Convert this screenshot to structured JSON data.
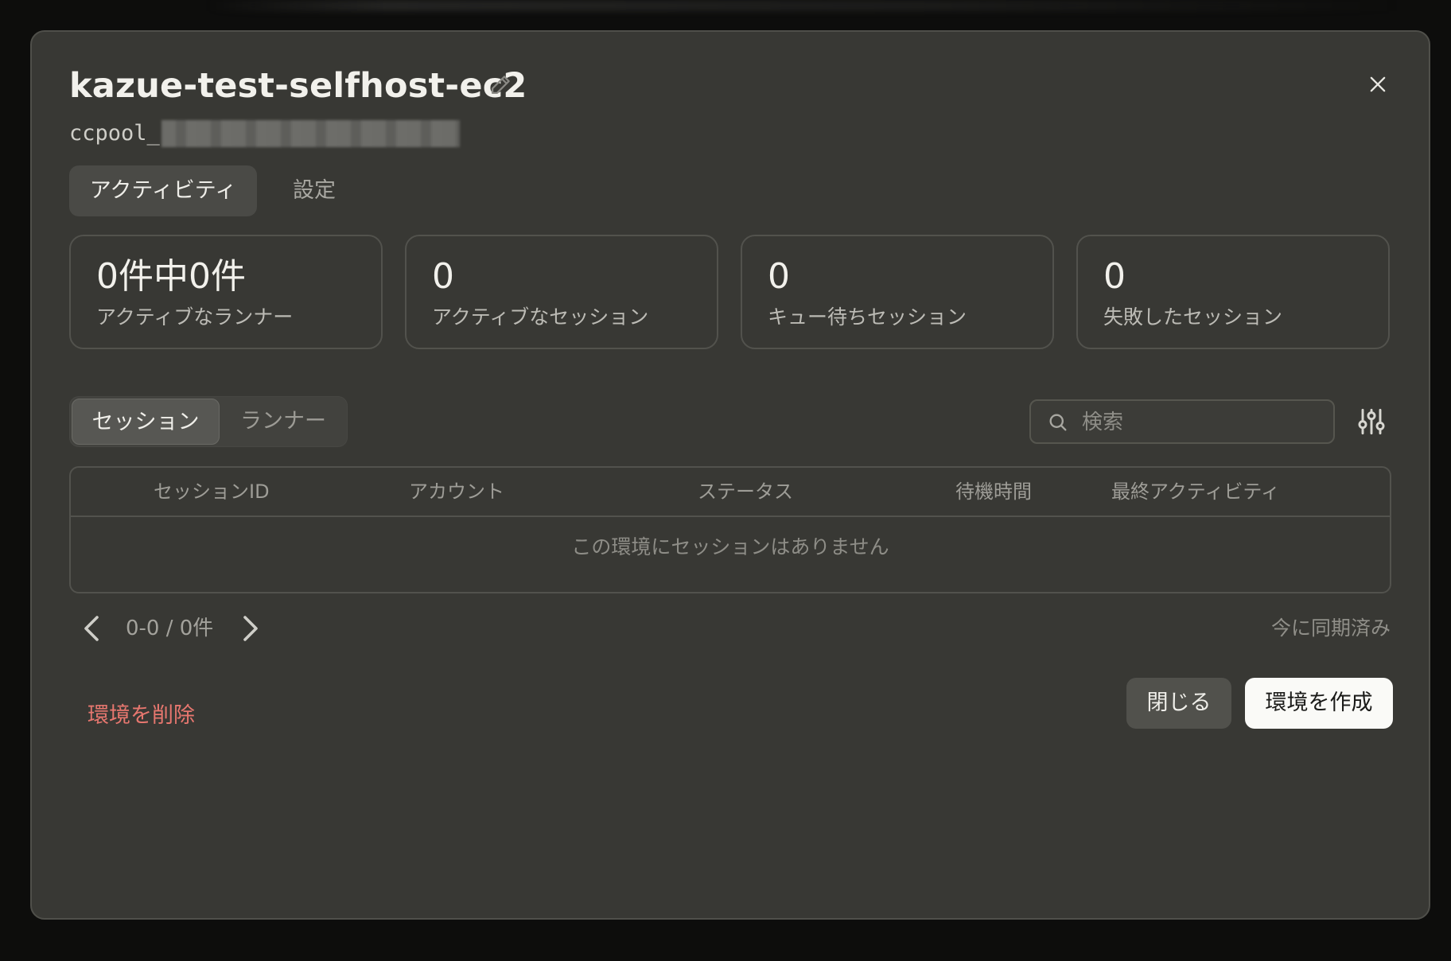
{
  "dialog": {
    "title": "kazue-test-selfhost-ec2",
    "pool_id_prefix": "ccpool_"
  },
  "tabs": [
    {
      "label": "アクティビティ",
      "active": true
    },
    {
      "label": "設定",
      "active": false
    }
  ],
  "stats": [
    {
      "value": "0件中0件",
      "label": "アクティブなランナー"
    },
    {
      "value": "0",
      "label": "アクティブなセッション"
    },
    {
      "value": "0",
      "label": "キュー待ちセッション"
    },
    {
      "value": "0",
      "label": "失敗したセッション"
    }
  ],
  "segments": [
    {
      "label": "セッション",
      "active": true
    },
    {
      "label": "ランナー",
      "active": false
    }
  ],
  "search": {
    "placeholder": "検索",
    "value": ""
  },
  "table": {
    "columns": [
      "セッションID",
      "アカウント",
      "ステータス",
      "待機時間",
      "最終アクティビティ"
    ],
    "empty_message": "この環境にセッションはありません"
  },
  "pagination": {
    "info": "0-0 / 0件"
  },
  "sync_status": "今に同期済み",
  "footer": {
    "delete_label": "環境を削除",
    "close_label": "閉じる",
    "create_label": "環境を作成"
  },
  "colors": {
    "modal_bg": "#383834",
    "danger": "#e7776f",
    "primary_button_bg": "#fafaf7"
  },
  "icons": {
    "edit": "pencil-icon",
    "close": "close-icon",
    "search": "search-icon",
    "filter": "sliders-icon",
    "prev": "chevron-left-icon",
    "next": "chevron-right-icon"
  }
}
